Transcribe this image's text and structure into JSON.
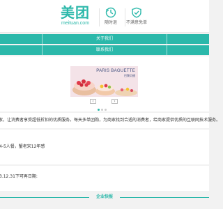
{
  "brand": {
    "logo_cn": "美团",
    "logo_en": "meituan.com",
    "accent_color": "#2bb8aa"
  },
  "features": [
    {
      "icon": "refresh-clock-icon",
      "label": "随时退"
    },
    {
      "icon": "shield-check-icon",
      "label": "不满意免单"
    }
  ],
  "nav": {
    "about": "关于我们",
    "contact": "联系我们"
  },
  "banner": {
    "brand_en": "PARIS BAGUETTE",
    "brand_cn": "巴黎贝甜",
    "prev": "‹",
    "next": "›",
    "slide_count": 3,
    "active_slide": 1
  },
  "content": {
    "description": "家，让消费者享受超低折扣的优质服务。每天多单团购，为商家找到合适的消费者，给商家提供优质的互联网技术服务。",
    "info_line": "4-5人餐，蟹老宋12年感",
    "validity_line": "3.12.31下可再日期:"
  },
  "footer": {
    "title": "企业快报"
  }
}
